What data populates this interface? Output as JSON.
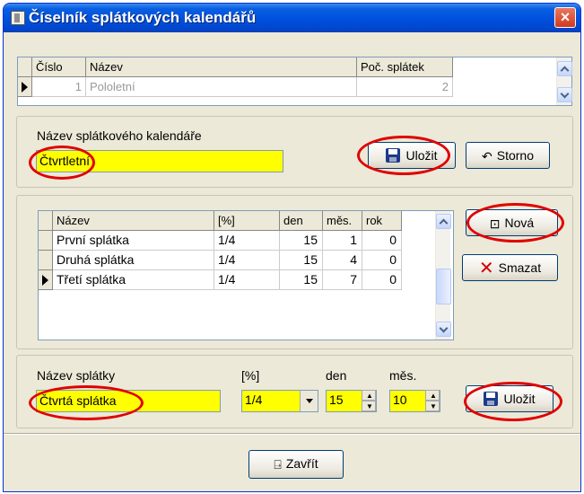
{
  "window": {
    "title": "Číselník splátkových kalendářů",
    "close_label": "×"
  },
  "calendars_grid": {
    "columns": [
      "Číslo",
      "Název",
      "Poč. splátek"
    ],
    "rows": [
      {
        "cislo": "1",
        "nazev": "Pololetní",
        "pocet": "2"
      }
    ]
  },
  "calendar_form": {
    "name_label": "Název splátkového kalendáře",
    "name_value": "Čtvrtletní",
    "save_label": "Uložit",
    "cancel_label": "Storno"
  },
  "installments_grid": {
    "columns": [
      "Název",
      "[%]",
      "den",
      "měs.",
      "rok"
    ],
    "rows": [
      {
        "nazev": "První splátka",
        "pct": "1/4",
        "den": "15",
        "mes": "1",
        "rok": "0"
      },
      {
        "nazev": "Druhá splátka",
        "pct": "1/4",
        "den": "15",
        "mes": "4",
        "rok": "0"
      },
      {
        "nazev": "Třetí splátka",
        "pct": "1/4",
        "den": "15",
        "mes": "7",
        "rok": "0"
      }
    ]
  },
  "installment_buttons": {
    "new_label": "Nová",
    "delete_label": "Smazat"
  },
  "installment_form": {
    "name_label": "Název splátky",
    "name_value": "Čtvrtá splátka",
    "pct_label": "[%]",
    "pct_value": "1/4",
    "den_label": "den",
    "den_value": "15",
    "mes_label": "měs.",
    "mes_value": "10",
    "save_label": "Uložit"
  },
  "footer": {
    "close_label": "Zavřít"
  },
  "colors": {
    "highlight": "#ffff00",
    "annotation": "#e00000",
    "titlebar": "#0052e0"
  }
}
